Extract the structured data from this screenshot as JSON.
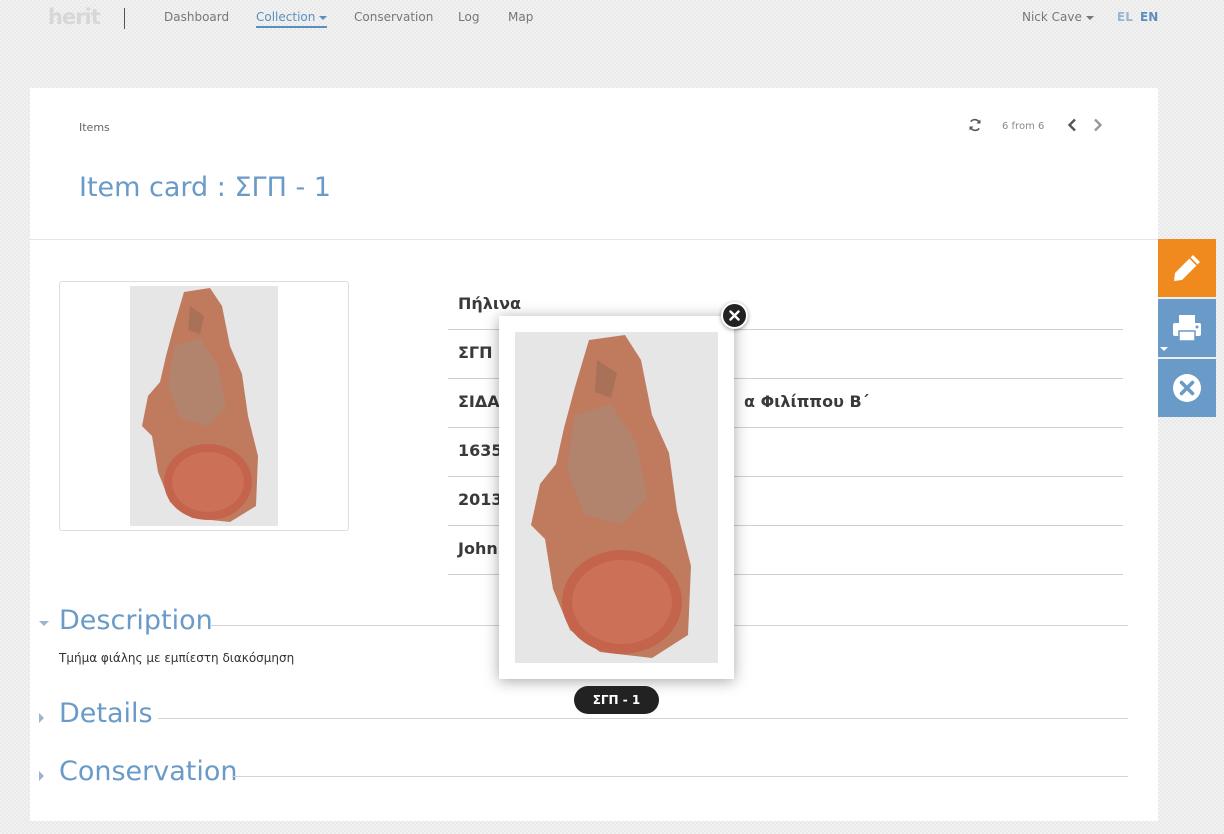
{
  "app": {
    "logo": "herit"
  },
  "nav": {
    "items": [
      {
        "label": "Dashboard"
      },
      {
        "label": "Collection"
      },
      {
        "label": "Conservation"
      },
      {
        "label": "Log"
      },
      {
        "label": "Map"
      }
    ],
    "user": "Nick Cave",
    "languages": [
      {
        "label": "EL"
      },
      {
        "label": "EN"
      }
    ],
    "active_color": "#5a8fc0"
  },
  "header": {
    "breadcrumb": "Items",
    "pager_text": "6 from 6",
    "title": "Item card : ΣΓΠ - 1"
  },
  "fields": [
    {
      "value": "Πήλινα"
    },
    {
      "value": "ΣΓΠ -"
    },
    {
      "value": "ΣΙΔΑΡ",
      "tail": "α Φιλίππου Β΄"
    },
    {
      "value": "1635"
    },
    {
      "value": "2013-"
    },
    {
      "value": "John"
    }
  ],
  "sections": {
    "description": {
      "title": "Description",
      "text": "Τμήμα φιάλης με εμπίεστη διακόσμηση"
    },
    "details": {
      "title": "Details"
    },
    "conservation": {
      "title": "Conservation"
    }
  },
  "side_actions": [
    {
      "icon": "pencil-icon",
      "color": "#f08a1e"
    },
    {
      "icon": "printer-icon",
      "color": "#6a9ac8"
    },
    {
      "icon": "close-circle-icon",
      "color": "#6a9ac8"
    }
  ],
  "lightbox": {
    "caption": "ΣΓΠ - 1"
  }
}
